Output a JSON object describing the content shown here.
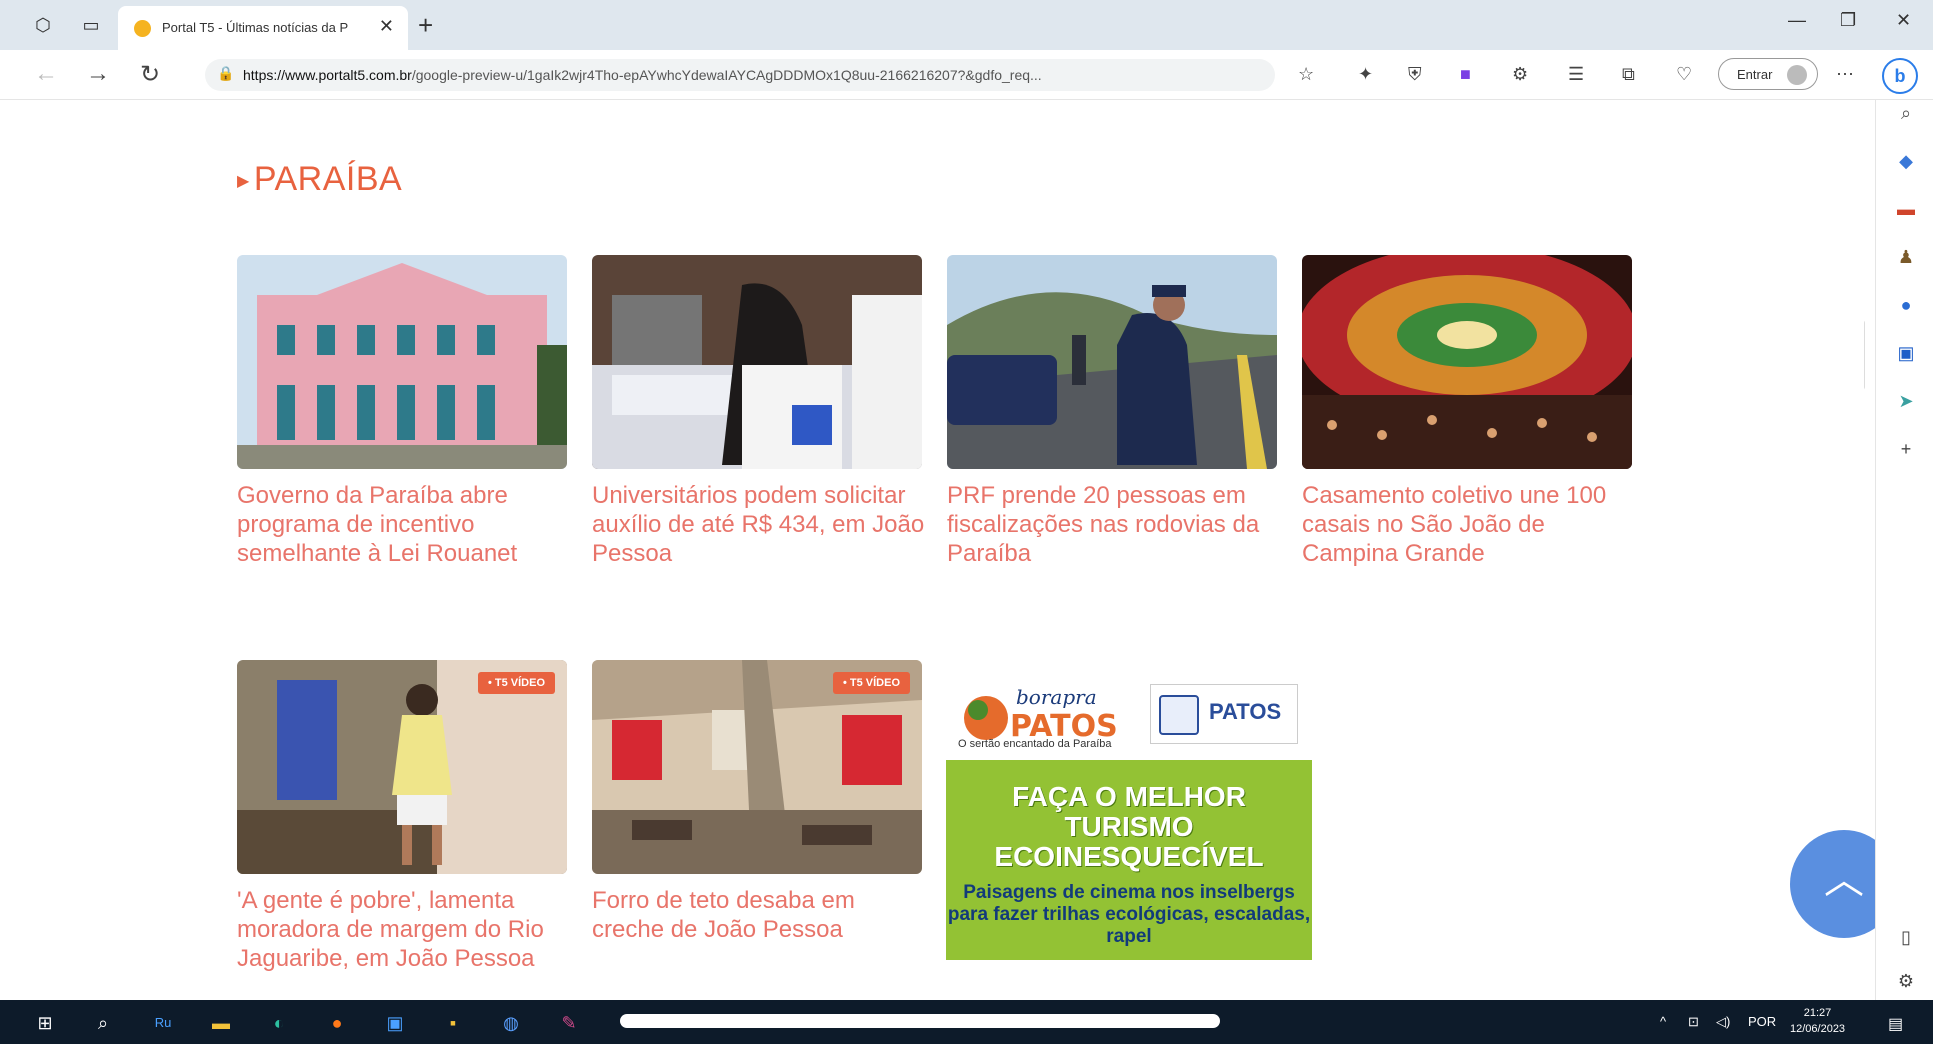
{
  "browser": {
    "tab_title": "Portal T5 - Últimas notícias da P",
    "url_host": "https://www.portalt5.com.br",
    "url_rest": "/google-preview-u/1gaIk2wjr4Tho-epAYwhcYdewaIAYCAgDDDMOx1Q8uu-2166216207?&gdfo_req...",
    "signin_label": "Entrar"
  },
  "page": {
    "section_title": "PARAÍBA",
    "articles_row1": [
      {
        "headline": "Governo da Paraíba abre programa de incentivo semelhante à Lei Rouanet"
      },
      {
        "headline": "Universitários podem solicitar auxílio de até R$ 434, em João Pessoa"
      },
      {
        "headline": "PRF prende 20 pessoas em fiscalizações nas rodovias da Paraíba"
      },
      {
        "headline": "Casamento coletivo une 100 casais no São João de Campina Grande"
      }
    ],
    "articles_row2": [
      {
        "headline": "'A gente é pobre', lamenta moradora de margem do Rio Jaguaribe, em João Pessoa",
        "badge": "• T5 VÍDEO"
      },
      {
        "headline": "Forro de teto desaba em creche de João Pessoa",
        "badge": "• T5 VÍDEO"
      }
    ],
    "ad": {
      "brand_top": "borapra",
      "brand_main": "PATOS",
      "slogan": "O sertão encantado da Paraíba",
      "partner": "PATOS",
      "cta": "FAÇA O MELHOR TURISMO ECOINESQUECÍVEL",
      "sub": "Paisagens de cinema nos inselbergs para fazer trilhas ecológicas, escaladas, rapel"
    }
  },
  "taskbar": {
    "lang": "POR",
    "time": "21:27",
    "date": "12/06/2023"
  },
  "colors": {
    "accent": "#e8623f",
    "headline": "#e8746a",
    "backtop": "#5a8fe0"
  }
}
